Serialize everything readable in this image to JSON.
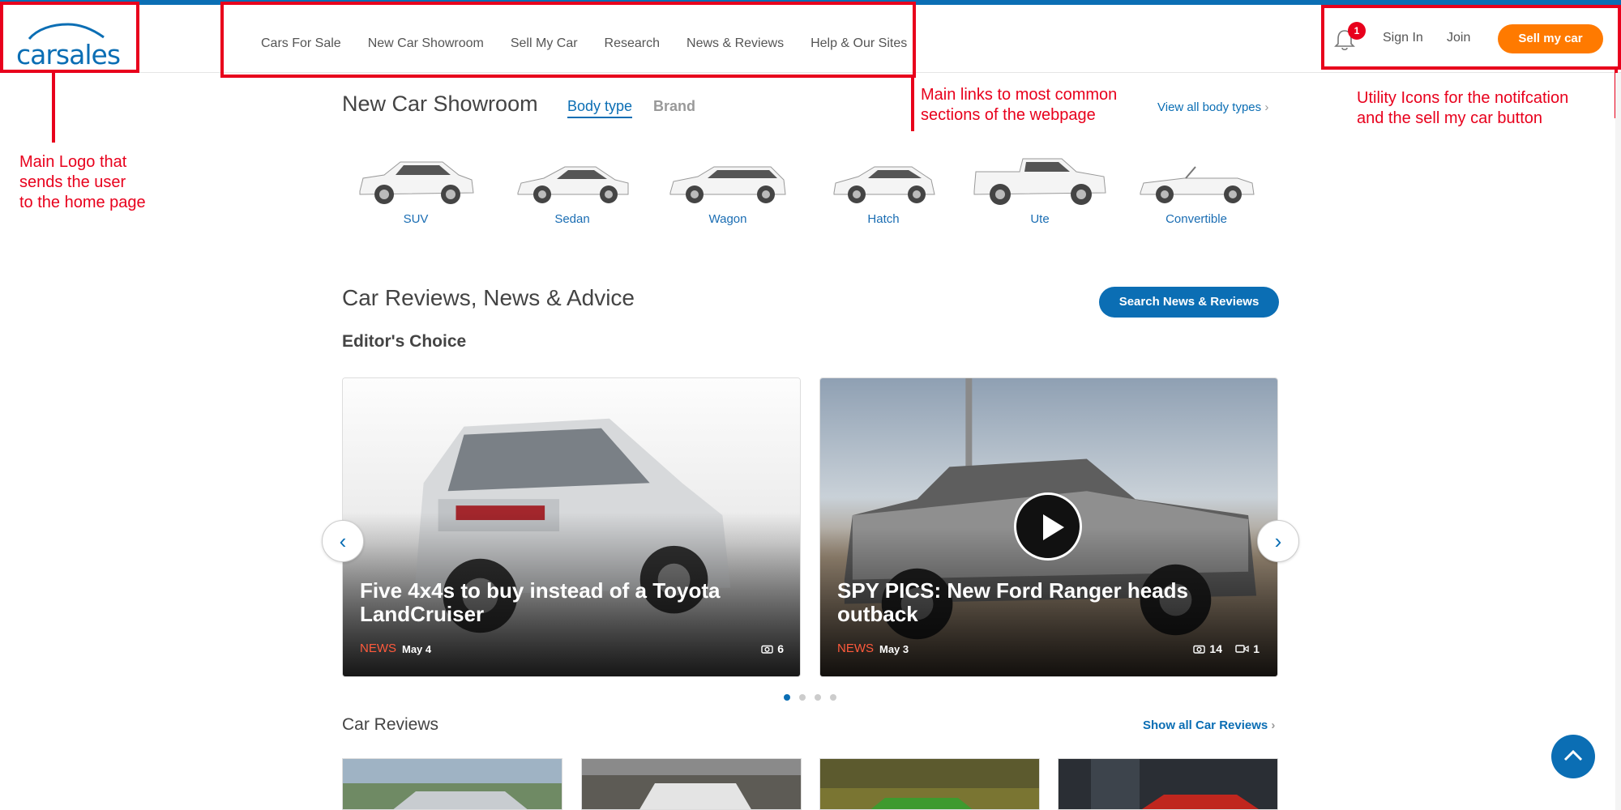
{
  "header": {
    "logo_text": "carsales",
    "nav": [
      "Cars For Sale",
      "New Car Showroom",
      "Sell My Car",
      "Research",
      "News & Reviews",
      "Help & Our Sites"
    ],
    "notification_count": "1",
    "sign_in": "Sign In",
    "join": "Join",
    "sell_button": "Sell my car"
  },
  "annotations": {
    "logo": "Main Logo that\nsends the user\nto the home page",
    "nav": "Main links to most common\nsections of the webpage",
    "utility": "Utility Icons for the notifcation\nand the sell my car button"
  },
  "showroom": {
    "title": "New Car Showroom",
    "tab_body": "Body type",
    "tab_brand": "Brand",
    "view_all": "View all body types",
    "body_types": [
      "SUV",
      "Sedan",
      "Wagon",
      "Hatch",
      "Ute",
      "Convertible"
    ]
  },
  "reviews": {
    "title": "Car Reviews, News & Advice",
    "search_button": "Search News & Reviews",
    "editors_choice": "Editor's Choice",
    "cards": [
      {
        "title": "Five 4x4s to buy instead of a Toyota LandCruiser",
        "tag": "NEWS",
        "date": "May 4",
        "photos": "6",
        "videos": ""
      },
      {
        "title": "SPY PICS: New Ford Ranger heads outback",
        "tag": "NEWS",
        "date": "May 3",
        "photos": "14",
        "videos": "1"
      }
    ],
    "carousel_pages": 4,
    "carousel_active": 1
  },
  "car_reviews": {
    "title": "Car Reviews",
    "show_all": "Show all Car Reviews"
  },
  "colors": {
    "brand_blue": "#0b6eb4",
    "sell_orange": "#ff7a00",
    "annotation_red": "#e8001c",
    "news_tag": "#ff5a3c"
  },
  "icons": [
    "car-logo-icon",
    "bell-icon",
    "chevron-right-icon",
    "camera-icon",
    "video-icon",
    "play-icon",
    "chevron-left-icon",
    "arrow-up-icon"
  ]
}
